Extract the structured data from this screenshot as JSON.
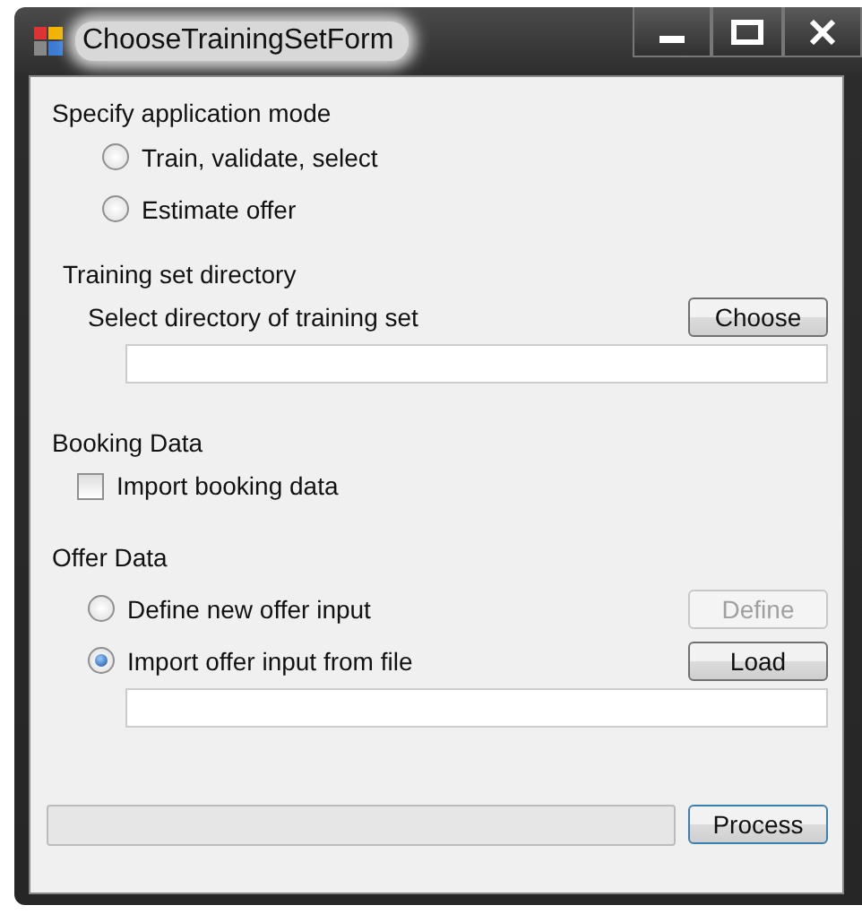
{
  "window": {
    "title": "ChooseTrainingSetForm"
  },
  "mode": {
    "title": "Specify application mode",
    "options": [
      {
        "label": "Train, validate, select",
        "selected": false
      },
      {
        "label": "Estimate offer",
        "selected": false
      }
    ]
  },
  "training": {
    "title": "Training set directory",
    "prompt": "Select directory of training set",
    "button": "Choose"
  },
  "booking": {
    "title": "Booking Data",
    "checkbox": {
      "label": "Import booking data",
      "checked": false
    }
  },
  "offer": {
    "title": "Offer Data",
    "options": [
      {
        "label": "Define new offer input",
        "selected": false,
        "button": {
          "label": "Define",
          "disabled": true
        }
      },
      {
        "label": "Import offer input from file",
        "selected": true,
        "button": {
          "label": "Load",
          "disabled": false
        }
      }
    ]
  },
  "progress": {
    "level": 0
  },
  "process_button": "Process"
}
